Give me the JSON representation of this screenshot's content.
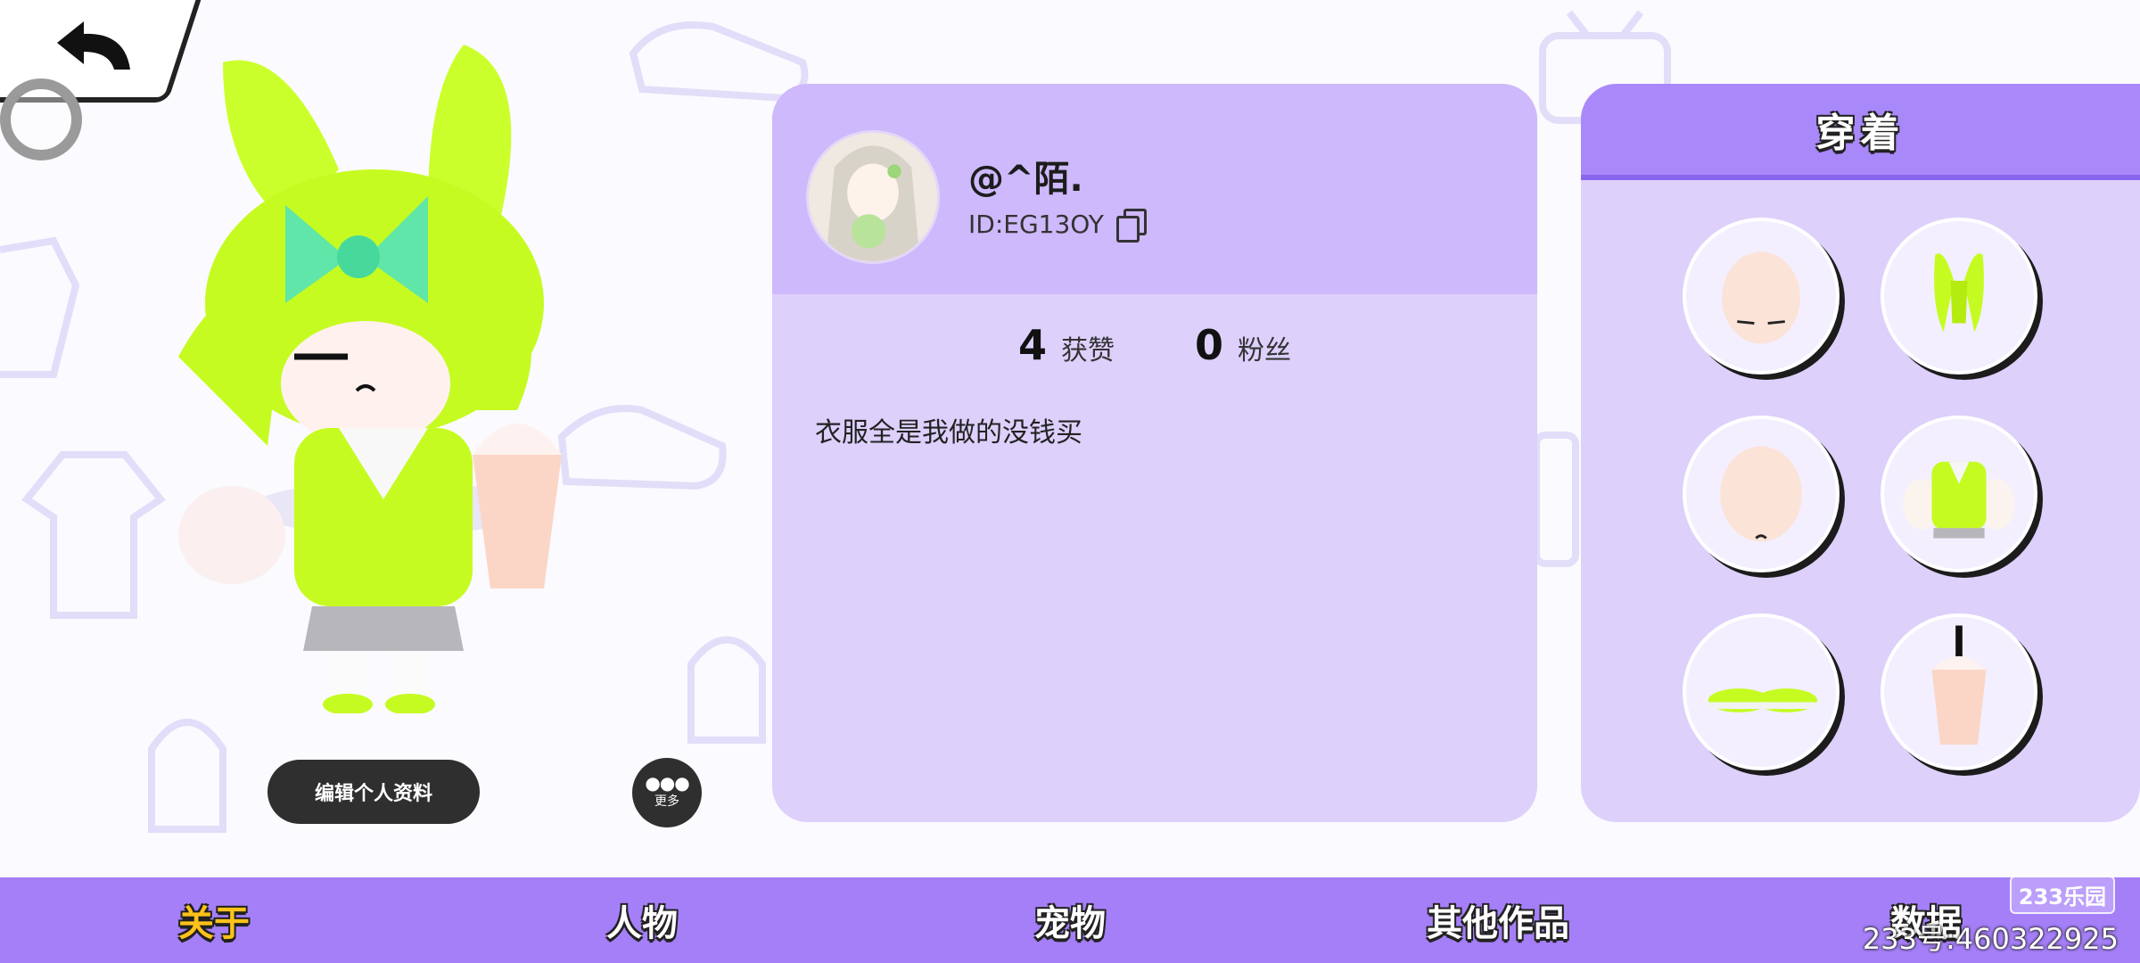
{
  "profile": {
    "nickname": "@^陌.",
    "user_id": "ID:EG13OY",
    "stats": [
      {
        "value": "4",
        "label": "获赞"
      },
      {
        "value": "0",
        "label": "粉丝"
      }
    ],
    "bio": "衣服全是我做的没钱买"
  },
  "actions": {
    "edit_profile": "编辑个人资料",
    "more": "更多"
  },
  "outfit": {
    "title": "穿着",
    "slots": [
      "face-icon",
      "hair-icon",
      "head-icon",
      "top-icon",
      "shoes-icon",
      "drink-icon"
    ]
  },
  "nav": {
    "tabs": [
      {
        "label": "关于",
        "active": true
      },
      {
        "label": "人物",
        "active": false
      },
      {
        "label": "宠物",
        "active": false
      },
      {
        "label": "其他作品",
        "active": false
      },
      {
        "label": "数据",
        "active": false
      }
    ]
  },
  "watermark": {
    "logo": "233乐园",
    "account": "233号:460322925"
  },
  "colors": {
    "accent": "#a57ff8",
    "card": "#ddd0fb",
    "active_tab": "#ffc21a"
  }
}
